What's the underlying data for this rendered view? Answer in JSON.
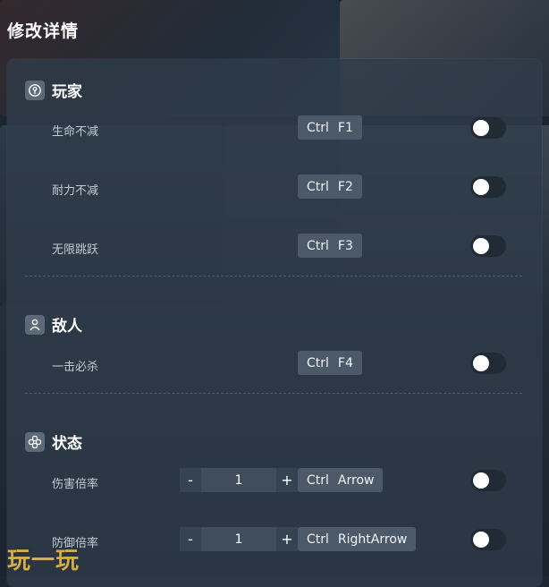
{
  "header": {
    "title": "修改详情"
  },
  "sections": [
    {
      "title": "玩家",
      "icon": "player-icon",
      "items": [
        {
          "label": "生命不减",
          "key1": "Ctrl",
          "key2": "F1",
          "enabled": false
        },
        {
          "label": "耐力不减",
          "key1": "Ctrl",
          "key2": "F2",
          "enabled": false
        },
        {
          "label": "无限跳跃",
          "key1": "Ctrl",
          "key2": "F3",
          "enabled": false
        }
      ]
    },
    {
      "title": "敌人",
      "icon": "person-icon",
      "items": [
        {
          "label": "一击必杀",
          "key1": "Ctrl",
          "key2": "F4",
          "enabled": false
        }
      ]
    },
    {
      "title": "状态",
      "icon": "status-icon",
      "items": [
        {
          "label": "伤害倍率",
          "value": "1",
          "minus": "-",
          "plus": "+",
          "key1": "Ctrl",
          "key2": "Arrow",
          "enabled": false
        },
        {
          "label": "防御倍率",
          "value": "1",
          "minus": "-",
          "plus": "+",
          "key1": "Ctrl",
          "key2": "RightArrow",
          "enabled": false
        }
      ]
    }
  ],
  "watermark": "玩一玩"
}
